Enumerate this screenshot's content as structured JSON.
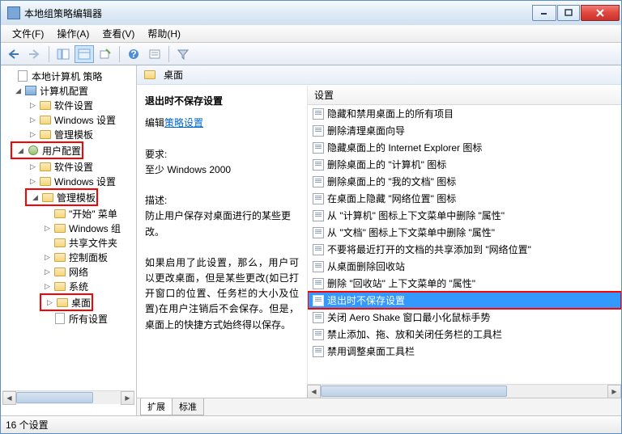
{
  "window": {
    "title": "本地组策略编辑器"
  },
  "menu": {
    "file": "文件(F)",
    "action": "操作(A)",
    "view": "查看(V)",
    "help": "帮助(H)"
  },
  "tree": {
    "root": "本地计算机 策略",
    "computer": "计算机配置",
    "comp_soft": "软件设置",
    "comp_win": "Windows 设置",
    "comp_tmpl": "管理模板",
    "user": "用户配置",
    "user_soft": "软件设置",
    "user_win": "Windows 设置",
    "user_tmpl": "管理模板",
    "start_menu": "\"开始\" 菜单",
    "win_group": "Windows 组",
    "shared": "共享文件夹",
    "control": "控制面板",
    "network": "网络",
    "system": "系统",
    "desktop": "桌面",
    "all_settings": "所有设置"
  },
  "right": {
    "header": "桌面",
    "detail_title": "退出时不保存设置",
    "edit_label": "编辑",
    "policy_link": "策略设置",
    "req_label": "要求:",
    "req_val": "至少 Windows 2000",
    "desc_label": "描述:",
    "desc_1": "防止用户保存对桌面进行的某些更改。",
    "desc_2": "如果启用了此设置，那么，用户可以更改桌面，但是某些更改(如已打开窗口的位置、任务栏的大小及位置)在用户注销后不会保存。但是，桌面上的快捷方式始终得以保存。",
    "col_setting": "设置",
    "tabs": {
      "ext": "扩展",
      "std": "标准"
    }
  },
  "settings": [
    "隐藏和禁用桌面上的所有项目",
    "删除清理桌面向导",
    "隐藏桌面上的 Internet Explorer 图标",
    "删除桌面上的 \"计算机\" 图标",
    "删除桌面上的 \"我的文档\" 图标",
    "在桌面上隐藏 \"网络位置\" 图标",
    "从 \"计算机\" 图标上下文菜单中删除 \"属性\"",
    "从 \"文档\" 图标上下文菜单中删除 \"属性\"",
    "不要将最近打开的文档的共享添加到 \"网络位置\"",
    "从桌面删除回收站",
    "删除 \"回收站\" 上下文菜单的 \"属性\"",
    "退出时不保存设置",
    "关闭 Aero Shake 窗口最小化鼠标手势",
    "禁止添加、拖、放和关闭任务栏的工具栏",
    "禁用调整桌面工具栏"
  ],
  "selected_index": 11,
  "status": "16 个设置"
}
